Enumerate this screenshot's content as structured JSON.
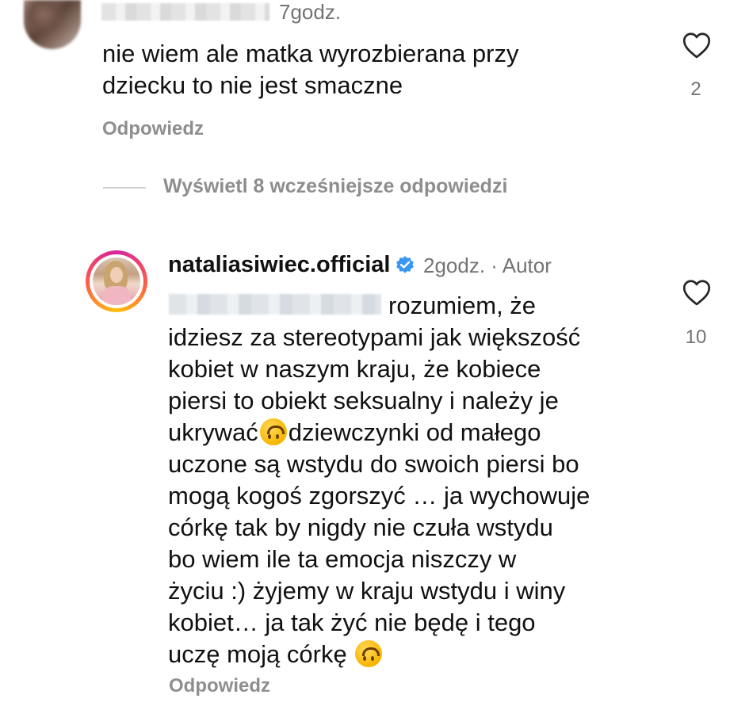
{
  "comment1": {
    "time": "7godz.",
    "text_lines": [
      "nie wiem ale matka wyrozbierana przy",
      "dziecku to nie jest smaczne"
    ],
    "likes": "2",
    "reply_label": "Odpowiedz"
  },
  "thread": {
    "view_more_label": "Wyświetl 8 wcześniejsze odpowiedzi"
  },
  "comment2": {
    "username": "nataliasiwiec.official",
    "time": "2godz. · Autor",
    "likes": "10",
    "line1_rest": "rozumiem, że",
    "lines": [
      "idziesz za stereotypami jak większość",
      "kobiet w naszym kraju, że kobiece",
      "piersi to obiekt seksualny i należy je"
    ],
    "line5_pre": "ukrywać",
    "line5_post": "dziewczynki od małego",
    "lines_after": [
      "uczone są wstydu do swoich piersi bo",
      "mogą kogoś zgorszyć … ja wychowuje",
      "córkę tak by nigdy nie czuła wstydu",
      "bo wiem ile ta emocja niszczy w",
      "życiu :) żyjemy w kraju wstydu i winy",
      "kobiet… ja tak żyć nie będę i tego"
    ],
    "last_line": "uczę moją córkę",
    "reply_label": "Odpowiedz",
    "emoji_icon": "upside-down-face-emoji"
  },
  "colors": {
    "text": "#111111",
    "muted": "#8e8e8e",
    "verified": "#3897f0"
  }
}
